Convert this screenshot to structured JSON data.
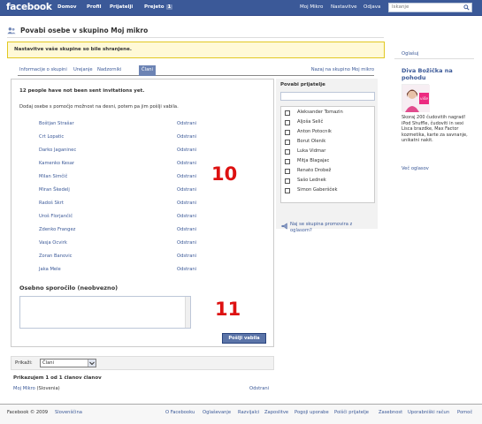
{
  "topbar": {
    "logo": "facebook",
    "nav": [
      "Domov",
      "Profil",
      "Prijatelji",
      "Prejeto"
    ],
    "inbox_count": "1",
    "right_nav": [
      "Moj Mikro",
      "Nastavitve",
      "Odjava"
    ],
    "search_placeholder": "Iskanje"
  },
  "page": {
    "title": "Povabi osebe v skupino Moj mikro",
    "notice": "Nastavitve vaše skupine so bile shranjene."
  },
  "tabs": {
    "items": [
      "Informacije o skupini",
      "Urejanje",
      "Nadzorniki",
      "Člani"
    ],
    "active": "Člani",
    "right_link": "Nazaj na skupino Moj mikro"
  },
  "invite": {
    "heading": "12 people have not been sent invitations yet.",
    "subtext": "Dodaj osebe s pomočjo možnost na desni, potem pa jim pošlji vabila.",
    "remove_label": "Odstrani",
    "names": [
      "Boštjan Strašar",
      "Crt Lopatic",
      "Darko Jaganinec",
      "Kamenko Kesar",
      "Milan Simčič",
      "Miran Škedelj",
      "Radoš Skrt",
      "Uroš Florjančič",
      "Zdenko Frangez",
      "Vasja Ocvirk",
      "Zoran Banovic",
      "Jaka Mele"
    ],
    "annotation_1": "10",
    "annotation_2": "11",
    "message_label": "Osebno sporočilo (neobvezno)",
    "send_button": "Pošlji vabila"
  },
  "friends_panel": {
    "title": "Povabi prijatelje",
    "names": [
      "Aleksander Tomazin",
      "Aljoša Selič",
      "Anton Potocnik",
      "Borut Olenik",
      "Luka Vidmar",
      "Mitja Blagajac",
      "Renato Drobež",
      "Sašo Lednek",
      "Simon Gaberšček"
    ],
    "promo_text": "Naj se skupina promovira z oglasom?"
  },
  "sidebar": {
    "ads_label": "Oglašuj",
    "ad_title": "Diva Božička na pohodu",
    "ad_image_text": "više",
    "ad_body": "Skoraj 200 čudovitih nagrad! iPod Shuffle, čudoviti in sexi Lisca brazdke, Max Factor kozmetika, karte za savnanje, unikatni nakit.",
    "more_ads": "Več oglasov"
  },
  "members": {
    "show_label": "Prikaži:",
    "show_value": "Člani",
    "count_label": "Prikazujem 1 od 1 članov članov",
    "member_name": "Moj Mikro",
    "member_country": "(Slovenia)",
    "remove_label": "Odstrani"
  },
  "footer": {
    "copyright": "Facebook © 2009",
    "language": "Slovenščina",
    "links": [
      "O Facebooku",
      "Oglaševanje",
      "Razvijalci",
      "Zaposlitve",
      "Pogoji uporabe",
      "Poišči prijatelje",
      "Zasebnost",
      "Uporabniški račun",
      "Pomoč"
    ]
  },
  "colors": {
    "brand": "#3b5998",
    "annotation": "#dd1111",
    "notice_bg": "#fff9d7"
  }
}
